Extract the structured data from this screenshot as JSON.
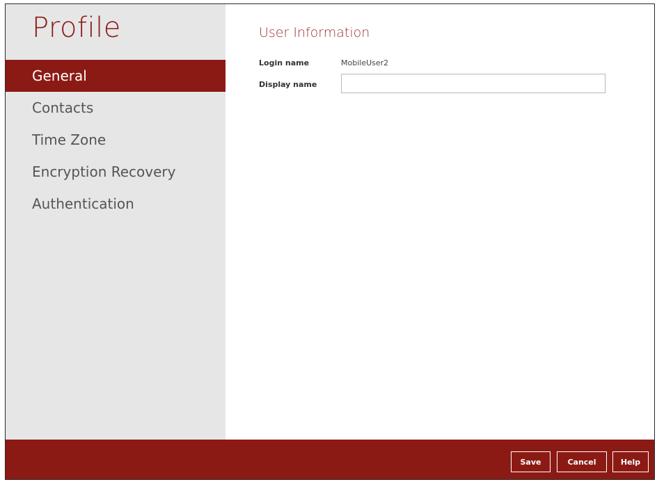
{
  "sidebar": {
    "title": "Profile",
    "items": [
      {
        "label": "General",
        "active": true
      },
      {
        "label": "Contacts",
        "active": false
      },
      {
        "label": "Time Zone",
        "active": false
      },
      {
        "label": "Encryption Recovery",
        "active": false
      },
      {
        "label": "Authentication",
        "active": false
      }
    ]
  },
  "main": {
    "section_title": "User Information",
    "login_name_label": "Login name",
    "login_name_value": "MobileUser2",
    "display_name_label": "Display name",
    "display_name_value": ""
  },
  "footer": {
    "save_label": "Save",
    "cancel_label": "Cancel",
    "help_label": "Help"
  },
  "colors": {
    "accent": "#8c1a14",
    "sidebar_bg": "#e6e6e6",
    "section_title": "#a0303a"
  }
}
